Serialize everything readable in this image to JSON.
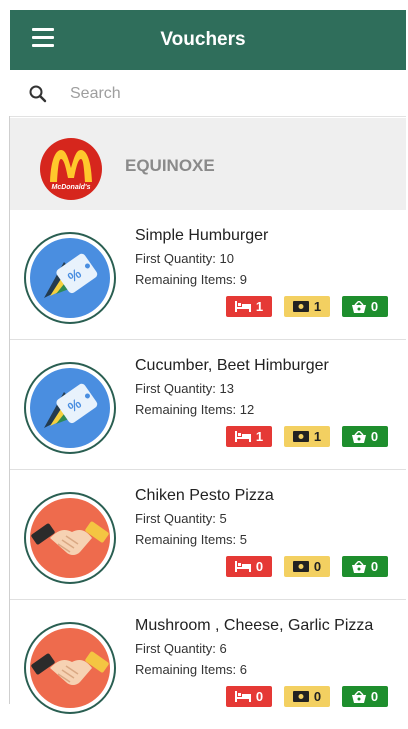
{
  "header": {
    "title": "Vouchers",
    "menu_icon": "hamburger-menu-icon",
    "bg_color": "#2f6e5b"
  },
  "search": {
    "placeholder": "Search",
    "value": "",
    "icon": "search-icon"
  },
  "store": {
    "name": "EQUINOXE",
    "logo_text": "McDonald's",
    "logo": "mcdonalds-logo"
  },
  "items": [
    {
      "name": "Simple Humburger",
      "first_quantity": "First Quantity: 10",
      "remaining": "Remaining Items:  9",
      "icon": "discount-tag-icon",
      "counts": {
        "red": "1",
        "yellow": "1",
        "green": "0"
      }
    },
    {
      "name": "Cucumber, Beet Himburger",
      "first_quantity": "First Quantity: 13",
      "remaining": "Remaining Items:  12",
      "icon": "discount-tag-icon",
      "counts": {
        "red": "1",
        "yellow": "1",
        "green": "0"
      }
    },
    {
      "name": "Chiken Pesto Pizza",
      "first_quantity": "First Quantity: 5",
      "remaining": "Remaining Items:  5",
      "icon": "handshake-icon",
      "counts": {
        "red": "0",
        "yellow": "0",
        "green": "0"
      }
    },
    {
      "name": "Mushroom , Cheese, Garlic Pizza",
      "first_quantity": "First Quantity: 6",
      "remaining": "Remaining Items:  6",
      "icon": "handshake-icon",
      "counts": {
        "red": "0",
        "yellow": "0",
        "green": "0"
      }
    }
  ],
  "badge_icons": {
    "red": "bed-icon",
    "yellow": "ticket-icon",
    "green": "basket-icon"
  },
  "colors": {
    "red": "#e53935",
    "yellow": "#f3d061",
    "green": "#1e8e2d"
  }
}
